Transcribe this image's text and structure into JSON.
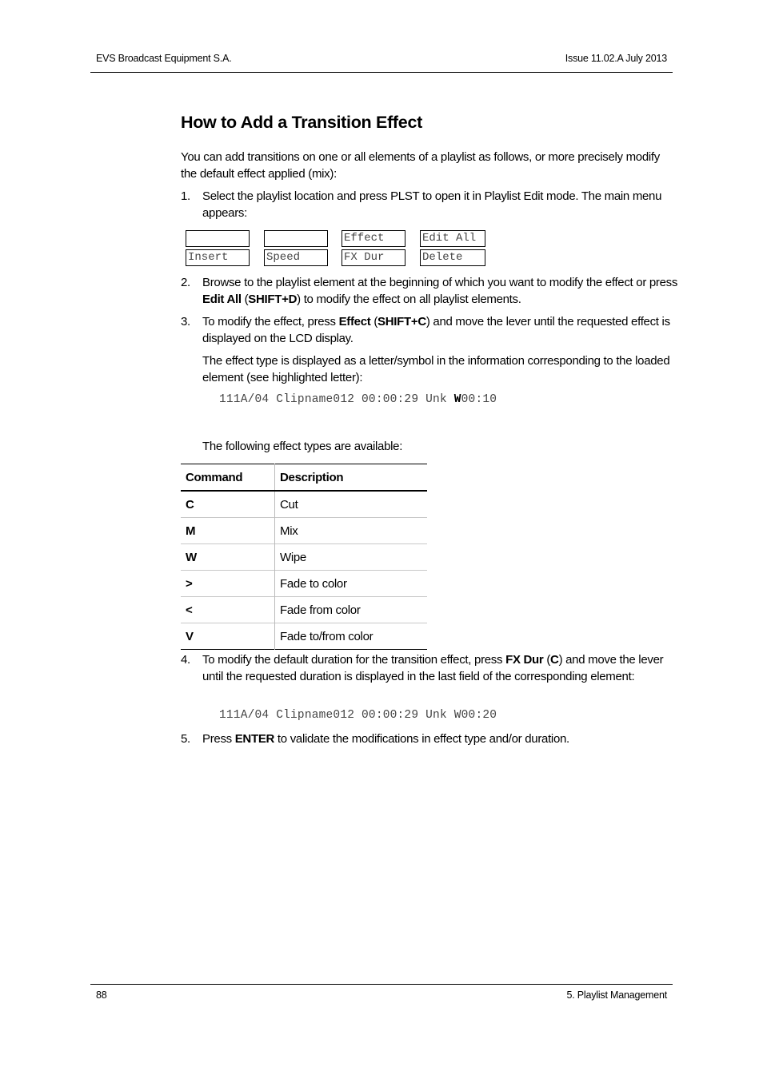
{
  "header": {
    "left": "EVS Broadcast Equipment S.A.",
    "right": "Issue 11.02.A  July 2013"
  },
  "footer": {
    "page_number": "88",
    "chapter": "5. Playlist Management"
  },
  "title": "How to Add a Transition Effect",
  "intro": "You can add transitions on one or all elements of a playlist as follows, or more precisely modify the default effect applied (mix):",
  "steps": [
    {
      "num": "1.",
      "text": "Select the playlist location and press PLST to open it in Playlist Edit mode. The main menu appears:"
    },
    {
      "num": "2.",
      "parts": [
        "Browse to the playlist element at the beginning of which you want to modify the effect or press ",
        "Edit All",
        " (",
        "SHIFT+D",
        ") to modify the effect on all playlist elements."
      ]
    },
    {
      "num": "3.",
      "parts": [
        "To modify the effect, press ",
        "Effect",
        " (",
        "SHIFT+C",
        ") and move the lever until the requested effect is displayed on the LCD display."
      ]
    },
    {
      "num": "4.",
      "parts": [
        "To modify the default duration for the transition effect, press ",
        "FX Dur",
        " (",
        "C",
        ") and move the lever until the requested duration is displayed in the last field of the corresponding element:"
      ]
    },
    {
      "num": "5.",
      "parts": [
        "Press ",
        "ENTER",
        " to validate the modifications in effect type and/or duration."
      ]
    }
  ],
  "lcd_menu": [
    {
      "top": "",
      "bottom": "Insert"
    },
    {
      "top": "",
      "bottom": "Speed"
    },
    {
      "top": "Effect",
      "bottom": "FX Dur"
    },
    {
      "top": "Edit All",
      "bottom": "Delete"
    }
  ],
  "step3_note": "The effect type is displayed as a letter/symbol in the information corresponding to the loaded element (see highlighted letter):",
  "display_line_1": {
    "before": "111A/04 Clipname012 00:00:29 Unk ",
    "highlight": "W",
    "after": "00:10"
  },
  "effects_intro": "The following effect types are available:",
  "effects_table": {
    "headers": [
      "Command",
      "Description"
    ],
    "rows": [
      [
        "C",
        "Cut"
      ],
      [
        "M",
        "Mix"
      ],
      [
        "W",
        "Wipe"
      ],
      [
        ">",
        "Fade to color"
      ],
      [
        "<",
        "Fade from color"
      ],
      [
        "V",
        "Fade to/from color"
      ]
    ]
  },
  "display_line_2": "111A/04 Clipname012 00:00:29 Unk W00:20"
}
